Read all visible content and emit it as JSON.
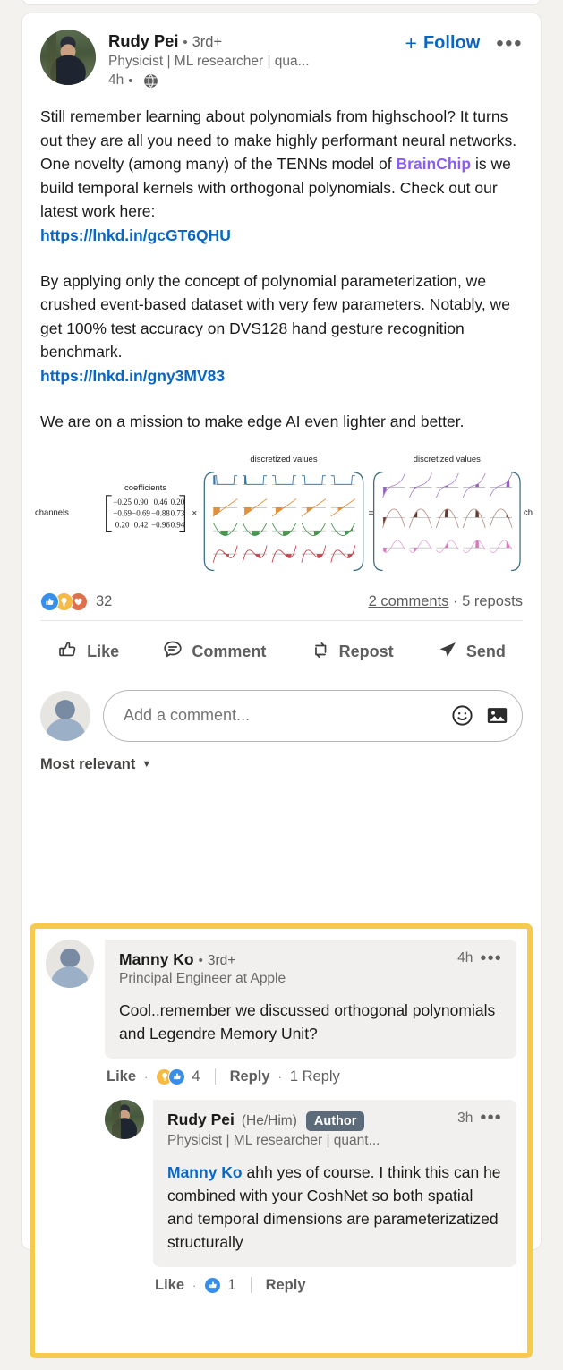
{
  "post": {
    "author": {
      "name": "Rudy Pei",
      "degree": "3rd+",
      "headline": "Physicist | ML researcher | qua...",
      "time": "4h",
      "visibility_icon": "globe-icon"
    },
    "follow_label": "Follow",
    "plus_symbol": "+",
    "menu_icon": "•••",
    "content": {
      "para1_a": "Still remember learning about polynomials from highschool? It turns out they are all you need to make highly performant neural networks. One novelty (among many) of the TENNs model of ",
      "mention1": "BrainChip",
      "para1_b": " is we build temporal kernels with orthogonal polynomials. Check out our latest work here:",
      "link1": "https://lnkd.in/gcGT6QHU",
      "para2": "By applying only the concept of polynomial parameterization, we crushed event-based dataset with very few parameters. Notably, we get 100% test accuracy on DVS128 hand gesture recognition benchmark.",
      "link2": "https://lnkd.in/gny3MV83",
      "para3": "We are on a mission to make edge AI even lighter and better."
    },
    "figure": {
      "left_label": "channels",
      "coefficients_label": "coefficients",
      "discretized_label_1": "discretized values",
      "discretized_label_2": "discretized values",
      "right_label": "channels",
      "multiply_symbol": "×",
      "equals_symbol": "=",
      "matrix": [
        [
          "−0.25",
          "0.90",
          "0.46",
          "0.20"
        ],
        [
          "−0.69",
          "−0.69",
          "−0.88",
          "0.73"
        ],
        [
          "0.20",
          "0.42",
          "−0.96",
          "0.94"
        ]
      ]
    },
    "social": {
      "reaction_icons": [
        "like-icon",
        "insight-icon",
        "love-icon"
      ],
      "reaction_count": "32",
      "comments_label": "2 comments",
      "separator": "·",
      "reposts_label": "5 reposts"
    },
    "actions": [
      {
        "label": "Like",
        "icon": "thumbs-up-icon"
      },
      {
        "label": "Comment",
        "icon": "speech-bubble-icon"
      },
      {
        "label": "Repost",
        "icon": "repost-arrows-icon"
      },
      {
        "label": "Send",
        "icon": "paper-plane-icon"
      }
    ],
    "comment_input": {
      "placeholder": "Add a comment...",
      "emoji_icon": "emoji-smiley-icon",
      "image_icon": "image-icon"
    },
    "sort": {
      "label": "Most relevant",
      "caret": "▼"
    }
  },
  "comments": [
    {
      "name": "Manny Ko",
      "degree": "3rd+",
      "headline": "Principal Engineer at Apple",
      "time": "4h",
      "menu_icon": "•••",
      "text": "Cool..remember we discussed orthogonal polynomials and Legendre Memory Unit?",
      "actions": {
        "like_label": "Like",
        "dot": "·",
        "reaction_icons": [
          "insight-icon",
          "like-icon"
        ],
        "reaction_count": "4",
        "reply_label": "Reply",
        "reply_count": "1 Reply"
      },
      "reply": {
        "name": "Rudy Pei",
        "pronouns": "(He/Him)",
        "badge": "Author",
        "headline": "Physicist | ML researcher | quant...",
        "time": "3h",
        "menu_icon": "•••",
        "mention": "Manny Ko",
        "text": " ahh yes of course. I think this can he combined with your CoshNet so both spatial and temporal dimensions are parameterizatized structurally",
        "actions": {
          "like_label": "Like",
          "dot": "·",
          "reaction_icons": [
            "like-icon"
          ],
          "reaction_count": "1",
          "reply_label": "Reply"
        }
      }
    }
  ],
  "colors": {
    "accent": "#0a66c2",
    "mention_purple": "#8b5cf6",
    "highlight": "#f5cb4e",
    "page_bg": "#f4f2ee"
  }
}
